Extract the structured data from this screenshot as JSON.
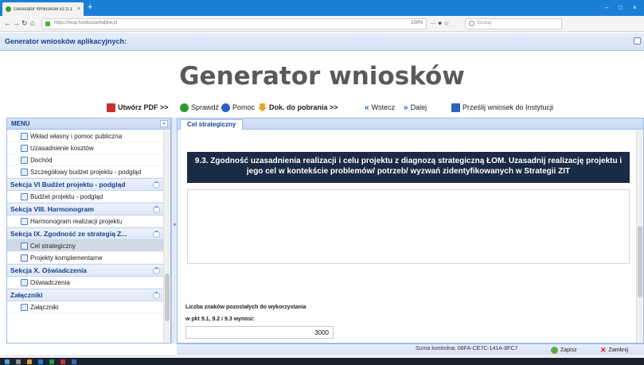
{
  "browser": {
    "tab_title": "Generator Wniosków v2.0.1",
    "tab_close": "×",
    "new_tab": "+",
    "url": "https://wup.fundusze/lsdjkw.pl",
    "zoom": "100%",
    "page_actions": "···  ♥  ☆",
    "search_placeholder": "Szukaj",
    "window_controls": [
      "–",
      "□",
      "×"
    ]
  },
  "app": {
    "title": "Generator wniosków aplikacyjnych:",
    "banner": "Generator wniosków"
  },
  "toolbar": {
    "pdf": "Utwórz PDF >>",
    "check": "Sprawdź",
    "help": "Pomoc",
    "download": "Dok. do pobrania >>",
    "back": "Wstecz",
    "next": "Dalej",
    "send": "Prześlij wniosek do Instytucji"
  },
  "menu": {
    "title": "MENU",
    "collapse": "«",
    "items": {
      "wklad": "Wkład własny i pomoc publiczna",
      "uzasadnienie": "Uzasadnienie kosztów",
      "dochod": "Dochód",
      "budzet_szczeg": "Szczegółowy budżet projektu - podgląd",
      "sec6": "Sekcja VI Budżet projektu - podgląd",
      "budzet_podglad": "Budżet projektu - podgląd",
      "sec8": "Sekcja VIII. Harmonogram",
      "harmonogram": "Harmonogram realizacji projektu",
      "sec9": "Sekcja IX. Zgodność ze strategią Z...",
      "cel": "Cel strategiczny",
      "projekty": "Projekty komplementarne",
      "sec10": "Sekcja X. Oświadczenia",
      "oswiadczenia": "Oświadczenia",
      "zal_sec": "Załączniki",
      "zalaczniki": "Załączniki"
    }
  },
  "main": {
    "tab": "Cel strategiczny",
    "question": "9.3. Zgodność uzasadnienia realizacji i celu projektu z diagnozą strategiczną ŁOM. Uzasadnij realizację projektu i jego cel w kontekście problemów/ potrzeb/ wyzwań zidentyfikowanych w Strategii ZIT",
    "answer": "",
    "chars_label_1": "Liczba znaków pozostałych do wykorzystania",
    "chars_label_2": "w pkt 9.1, 9.2 i 9.3 wynosi:",
    "chars_value": "3000"
  },
  "footer": {
    "checksum": "Suma kontrolna: 08FA-CE7C-141A-8FC7",
    "save": "Zapisz",
    "close": "Zamknij"
  },
  "colors": {
    "accent": "#15428b",
    "question_bg": "#1b2a45",
    "browser_bar": "#1c7fd6"
  }
}
